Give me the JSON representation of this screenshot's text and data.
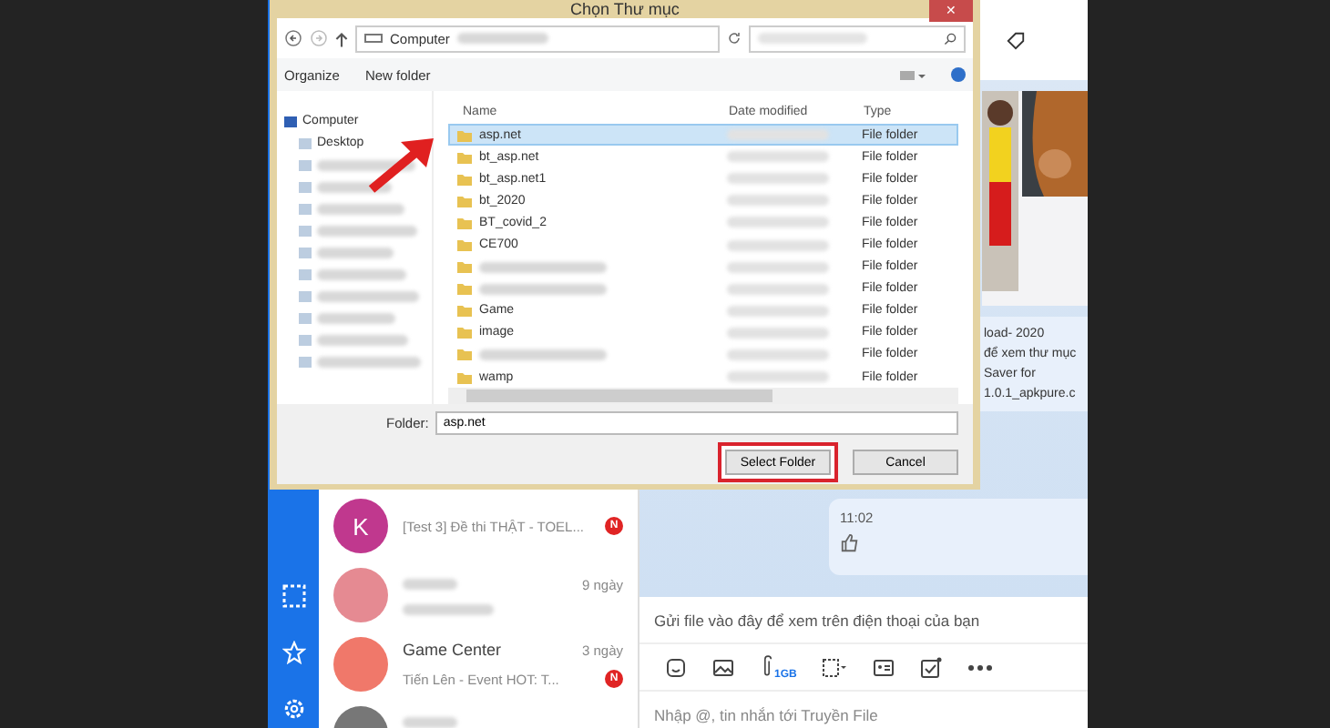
{
  "dialog": {
    "title": "Chọn Thư mục",
    "close": "✕",
    "address": "Computer",
    "toolbar": [
      "Organize",
      "New folder"
    ],
    "nav_tree": [
      {
        "label": "Computer",
        "kind": "item",
        "children": [
          {
            "label": "Desktop",
            "kind": "item"
          },
          {
            "kind": "blurred"
          },
          {
            "kind": "blurred"
          },
          {
            "kind": "blurred"
          },
          {
            "kind": "blurred"
          },
          {
            "kind": "blurred"
          },
          {
            "kind": "blurred"
          },
          {
            "kind": "blurred"
          },
          {
            "kind": "blurred"
          },
          {
            "kind": "blurred"
          },
          {
            "kind": "blurred"
          }
        ]
      }
    ],
    "columns": [
      "Name",
      "Date modified",
      "Type"
    ],
    "rows": [
      {
        "name": "asp.net",
        "kind": "item",
        "type": "File folder",
        "selected": true
      },
      {
        "name": "bt_asp.net",
        "kind": "item",
        "type": "File folder",
        "selected": false
      },
      {
        "name": "bt_asp.net1",
        "kind": "item",
        "type": "File folder",
        "selected": false
      },
      {
        "name": "bt_2020",
        "kind": "item",
        "type": "File folder",
        "selected": false
      },
      {
        "name": "BT_covid_2",
        "kind": "item",
        "type": "File folder",
        "selected": false
      },
      {
        "name": "CE700",
        "kind": "item",
        "type": "File folder",
        "selected": false
      },
      {
        "kind": "blurred",
        "type": "File folder",
        "selected": false
      },
      {
        "kind": "blurred",
        "type": "File folder",
        "selected": false
      },
      {
        "name": "Game",
        "kind": "item",
        "type": "File folder",
        "selected": false
      },
      {
        "name": "image",
        "kind": "item",
        "type": "File folder",
        "selected": false
      },
      {
        "kind": "blurred",
        "type": "File folder",
        "selected": false
      },
      {
        "name": "wamp",
        "kind": "item",
        "type": "File folder",
        "selected": false
      }
    ],
    "folder_label": "Folder:",
    "folder_value": "asp.net",
    "buttons": [
      {
        "label": "Select Folder",
        "highlighted": true
      },
      {
        "label": "Cancel",
        "highlighted": false
      }
    ]
  },
  "conversations": [
    {
      "avatar": "K",
      "color": "#c0388e",
      "title": "[Test 3] Đề thi THẬT - TOEL...",
      "badge": "N"
    },
    {
      "color": "#e58a92",
      "time": "9 ngày"
    },
    {
      "color": "#f0786a",
      "title": "Game Center",
      "time": "3 ngày",
      "preview": "Tiến Lên - Event HOT: T...",
      "badge": "N"
    },
    {
      "color": "#777777"
    }
  ],
  "chat": {
    "messages": [
      "load- 2020",
      "để xem thư mục",
      "Saver for",
      "1.0.1_apkpure.c"
    ],
    "time": "11:02",
    "drop_hint": "Gửi file vào đây để xem trên điện thoại của bạn",
    "attach_badge": "1GB",
    "input_placeholder": "Nhập @, tin nhắn tới Truyền File"
  }
}
